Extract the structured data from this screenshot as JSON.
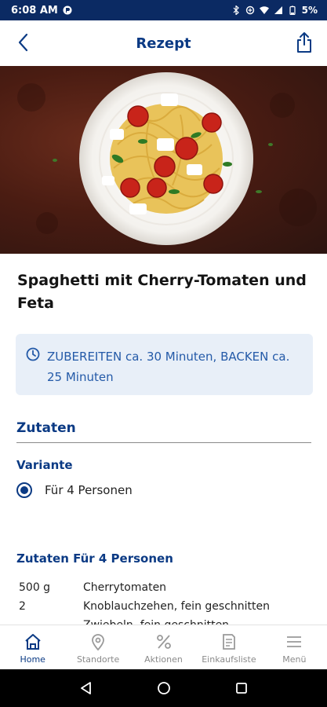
{
  "status_bar": {
    "time": "6:08 AM",
    "battery": "5%"
  },
  "header": {
    "title": "Rezept"
  },
  "recipe": {
    "title": "Spaghetti mit Cherry-Tomaten und Feta",
    "time_info": "ZUBEREITEN ca. 30 Minuten, BACKEN ca. 25 Minuten"
  },
  "ingredients_section": {
    "title": "Zutaten",
    "variant_label": "Variante",
    "variant_option": "Für 4 Personen",
    "list_title": "Zutaten Für 4 Personen",
    "items": [
      {
        "amount": "500 g",
        "name": "Cherrytomaten"
      },
      {
        "amount": "2",
        "name": "Knoblauchzehen, fein geschnitten"
      },
      {
        "amount": "",
        "name": "Zwiebeln, fein geschnitten"
      }
    ]
  },
  "bottom_nav": {
    "items": [
      {
        "label": "Home",
        "icon": "home-icon"
      },
      {
        "label": "Standorte",
        "icon": "location-pin-icon"
      },
      {
        "label": "Aktionen",
        "icon": "percent-icon"
      },
      {
        "label": "Einkaufsliste",
        "icon": "shopping-list-icon"
      },
      {
        "label": "Menü",
        "icon": "menu-icon"
      }
    ]
  },
  "colors": {
    "brand_blue": "#0b3a84",
    "status_bar": "#0b2a63",
    "info_box_bg": "#e8eff8"
  }
}
